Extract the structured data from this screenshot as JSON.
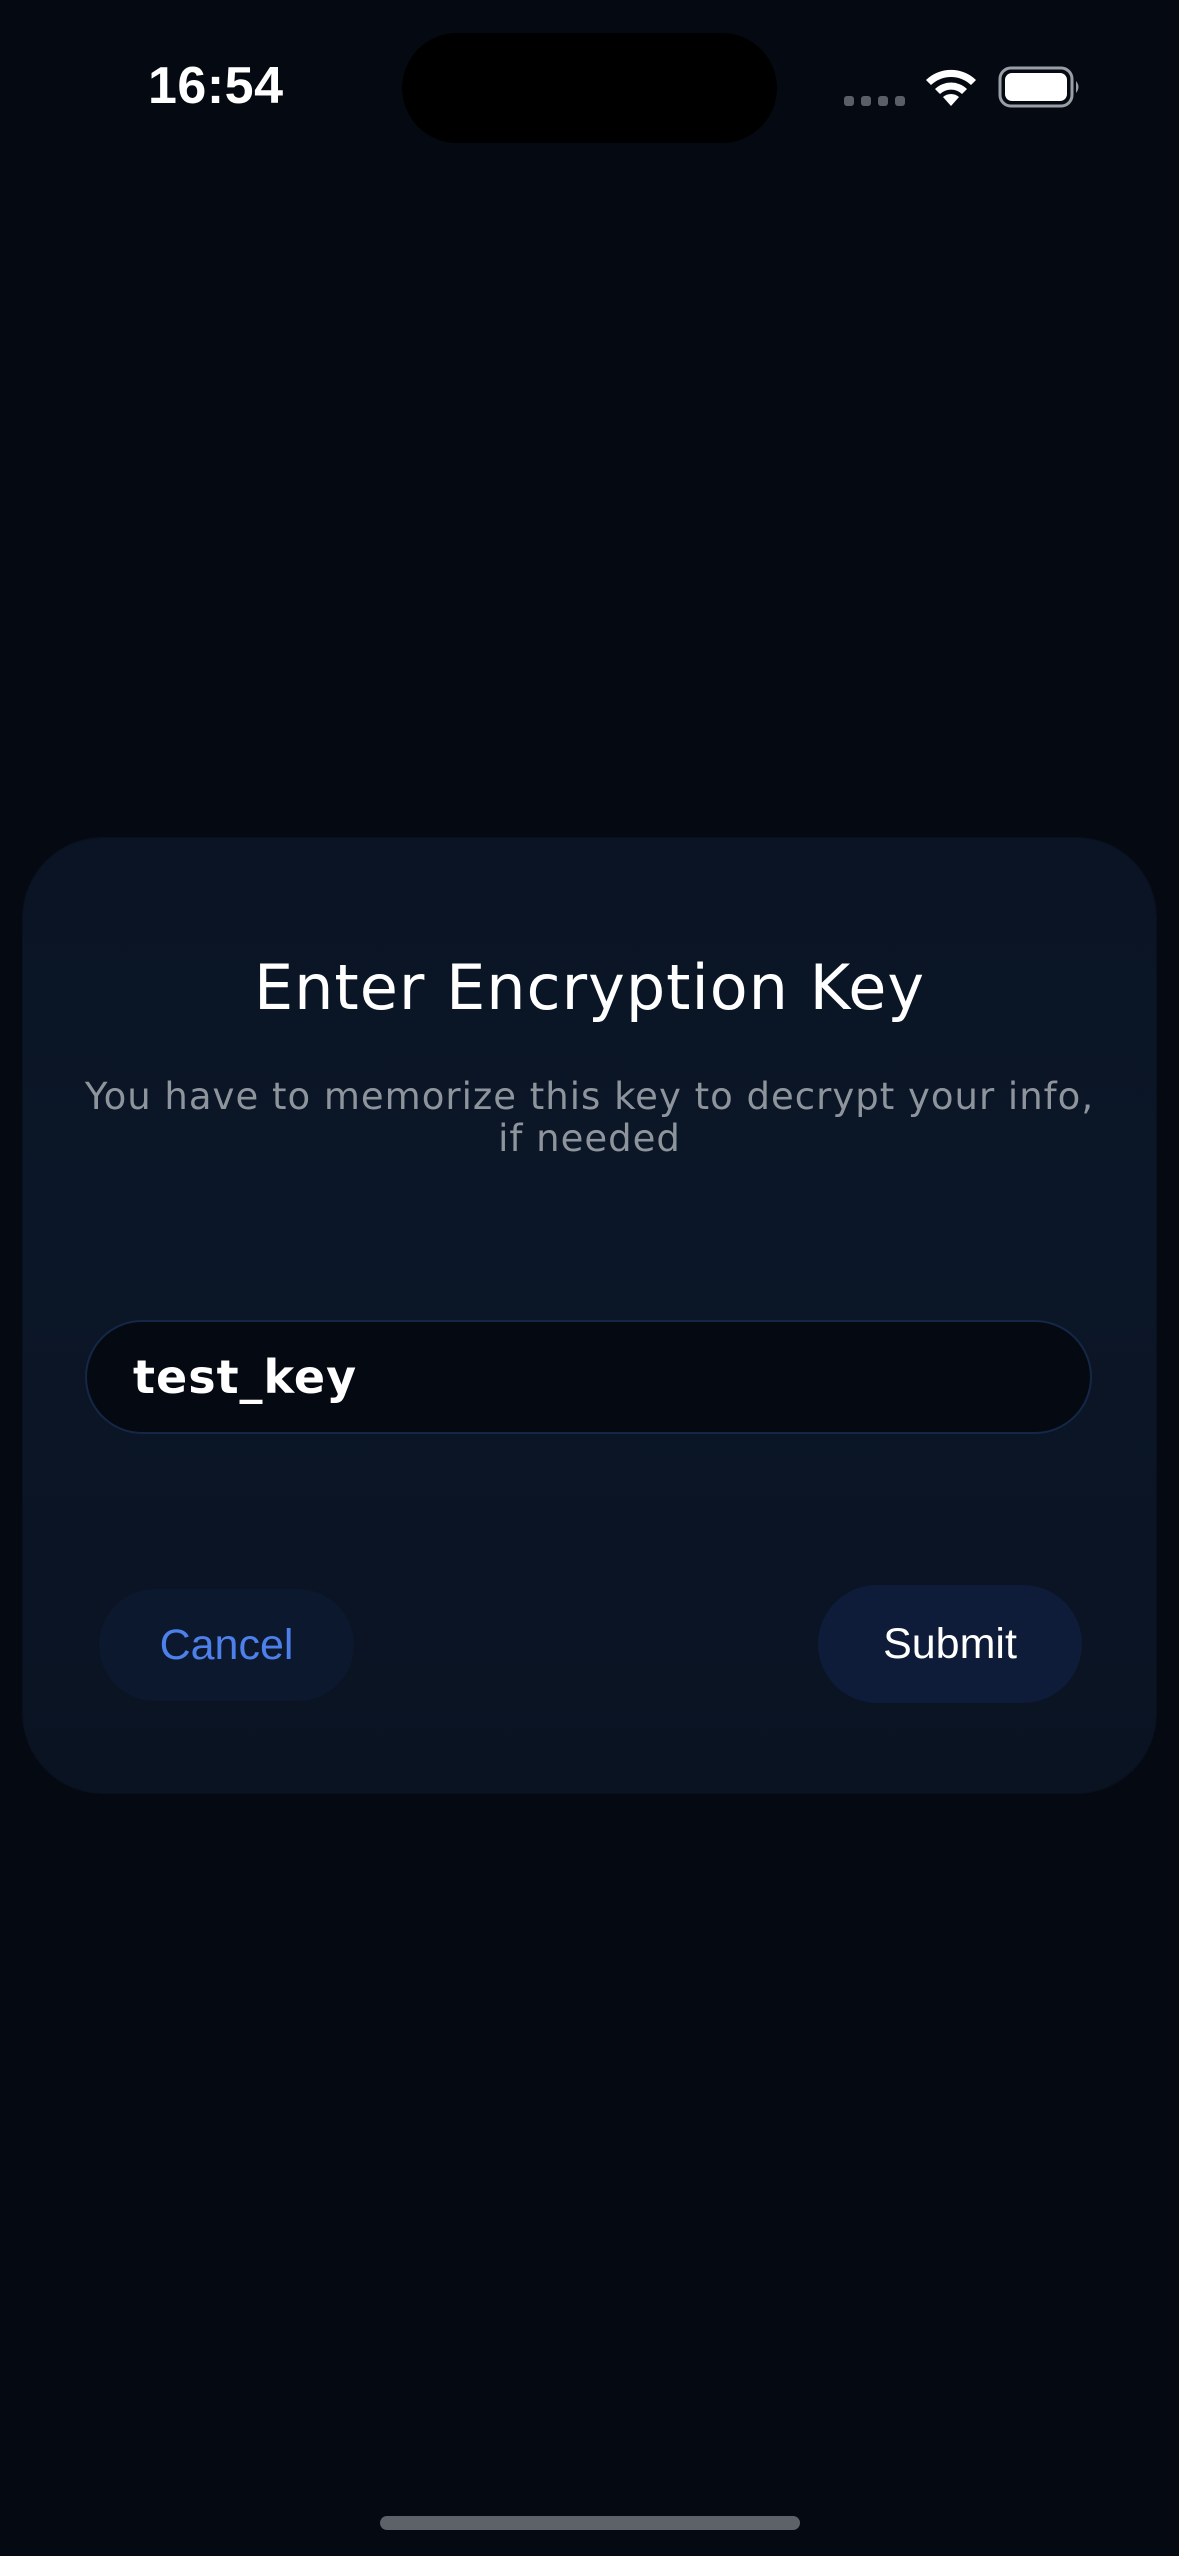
{
  "status_bar": {
    "time": "16:54",
    "icons": [
      "signal-dots-icon",
      "wifi-icon",
      "battery-icon"
    ]
  },
  "dialog": {
    "title": "Enter Encryption Key",
    "subtitle": "You have to memorize this key to decrypt your info, if needed",
    "key_input": {
      "value": "test_key",
      "placeholder": ""
    },
    "cancel_label": "Cancel",
    "submit_label": "Submit"
  },
  "colors": {
    "background": "#050a12",
    "dialog": "#0b1628",
    "accent": "#4d80ea",
    "muted_text": "#8e949c",
    "submit_bg": "#0e1c3a"
  }
}
